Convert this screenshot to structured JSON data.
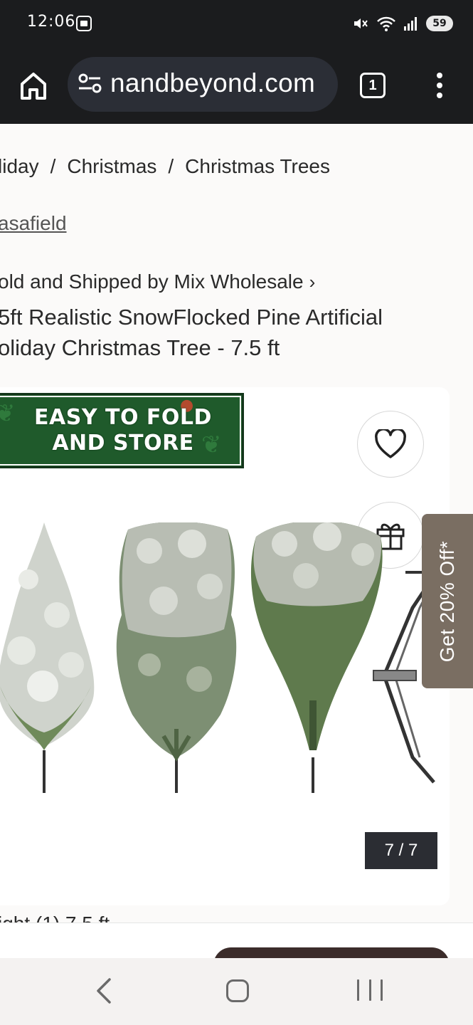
{
  "status_bar": {
    "time": "12:06",
    "battery": "59",
    "icons": [
      "screenshot-icon",
      "mute-icon",
      "wifi-icon",
      "signal-icon",
      "battery-icon"
    ]
  },
  "browser": {
    "url": "nandbeyond.com",
    "tab_count": "1"
  },
  "breadcrumb": {
    "items": [
      "liday",
      "Christmas",
      "Christmas Trees"
    ],
    "separator": "/"
  },
  "brand": "asafield",
  "seller_line": "old and Shipped by Mix Wholesale",
  "product_title": "5ft Realistic SnowFlocked Pine Artificial oliday Christmas Tree - 7.5 ft",
  "gallery": {
    "banner_text_line1": "EASY TO FOLD",
    "banner_text_line2": "AND STORE",
    "counter": "7 / 7"
  },
  "side_promo": "Get 20% Off*",
  "partial_text": "ight (1) 7.5 ft",
  "colors": {
    "status_bar_bg": "#1b1c1e",
    "url_box_bg": "#2b2e36",
    "banner_green": "#1f5a2b",
    "side_tab_bg": "#7a6e62",
    "counter_bg": "#2b2d33",
    "sticky_button": "#3b2c2a"
  }
}
